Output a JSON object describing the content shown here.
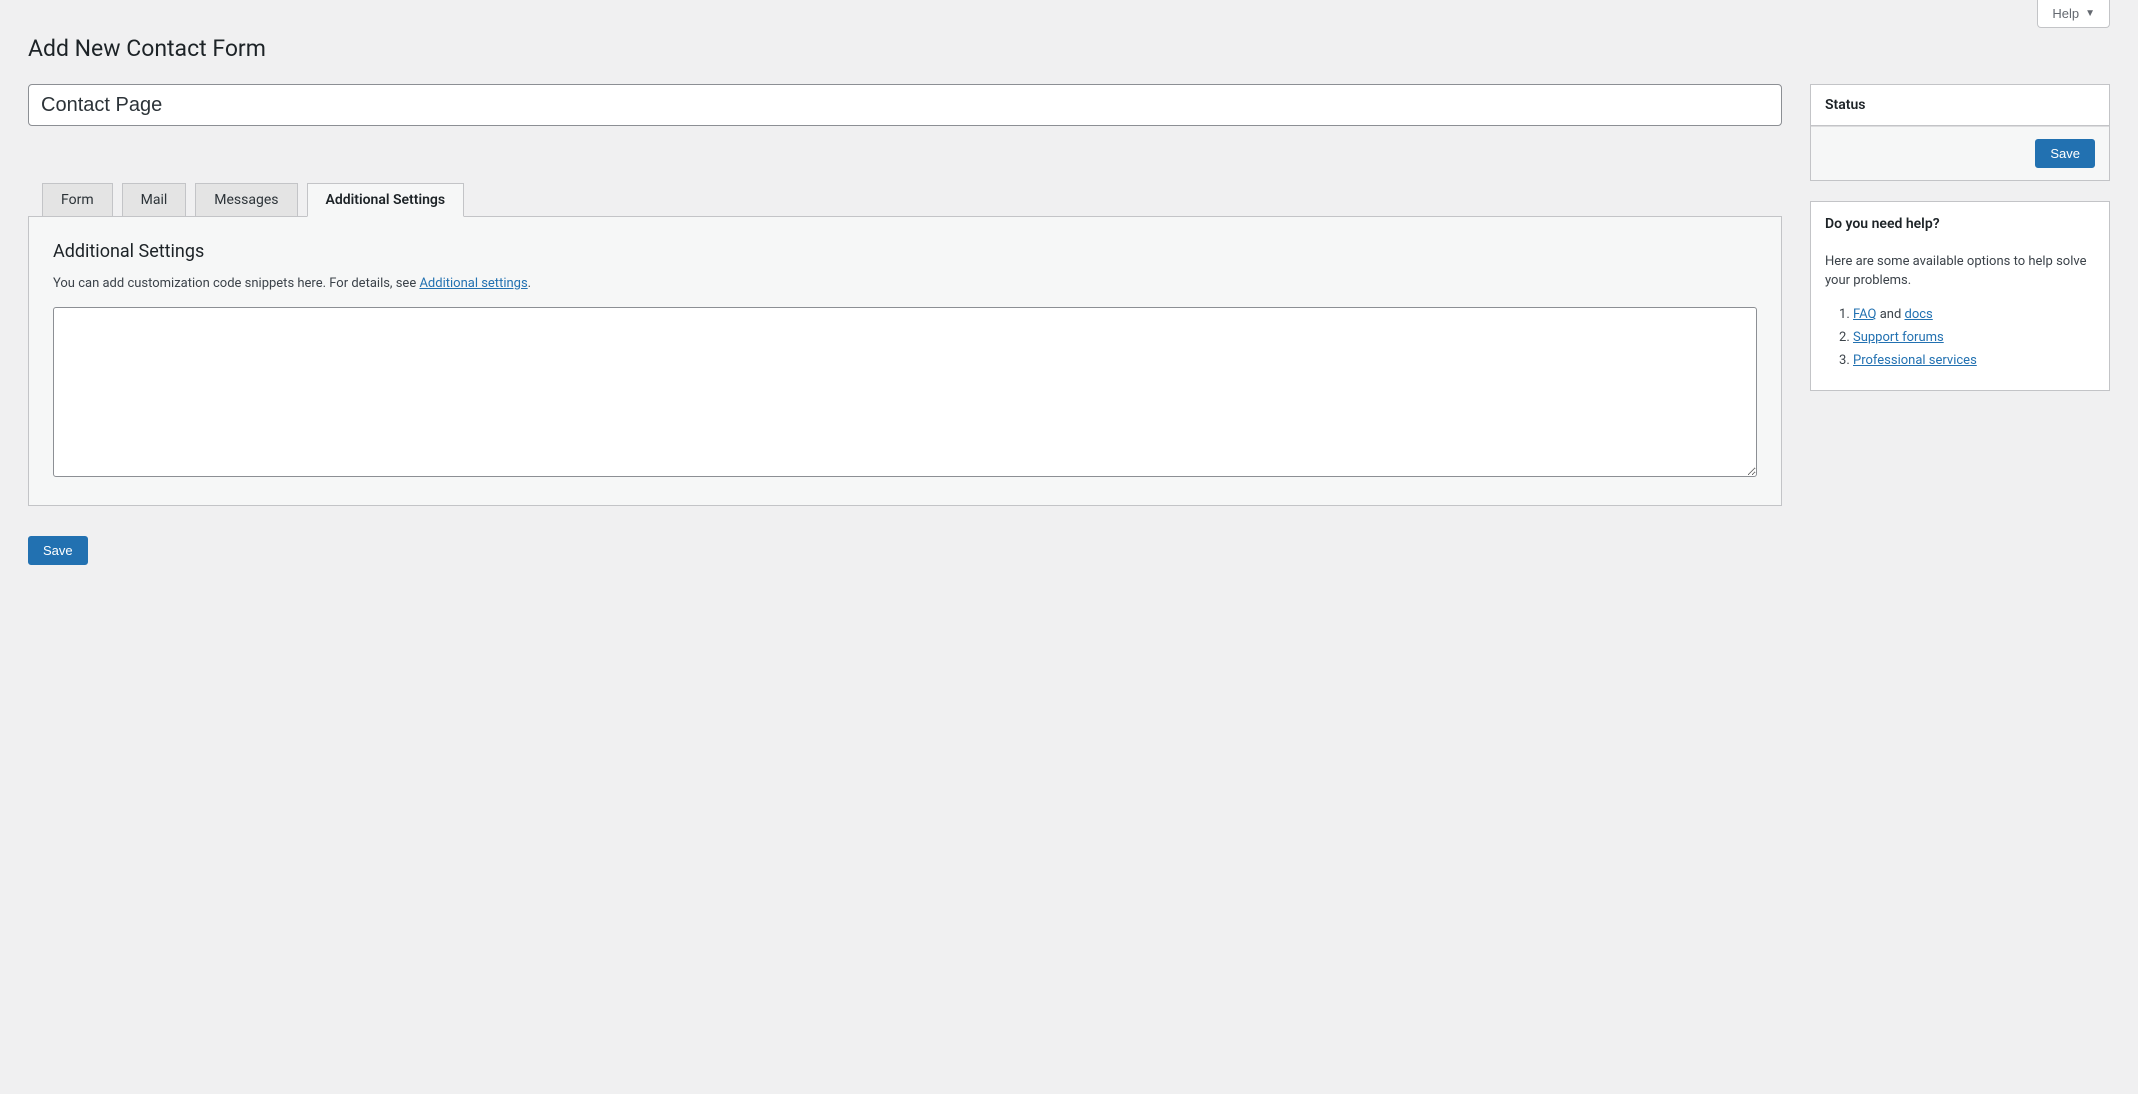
{
  "top": {
    "help_label": "Help"
  },
  "page": {
    "title": "Add New Contact Form",
    "form_title_value": "Contact Page"
  },
  "tabs": {
    "form": "Form",
    "mail": "Mail",
    "messages": "Messages",
    "additional_settings": "Additional Settings"
  },
  "panel": {
    "heading": "Additional Settings",
    "description_prefix": "You can add customization code snippets here. For details, see ",
    "description_link": "Additional settings",
    "description_suffix": ".",
    "textarea_value": ""
  },
  "buttons": {
    "save": "Save"
  },
  "sidebar": {
    "status": {
      "heading": "Status",
      "save_label": "Save"
    },
    "help": {
      "heading": "Do you need help?",
      "intro": "Here are some available options to help solve your problems.",
      "items": [
        {
          "prefix_link": "FAQ",
          "middle": " and ",
          "suffix_link": "docs"
        },
        {
          "link": "Support forums"
        },
        {
          "link": "Professional services"
        }
      ]
    }
  }
}
